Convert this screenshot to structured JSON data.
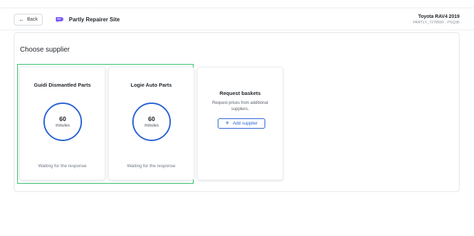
{
  "header": {
    "back_label": "Back",
    "brand_name": "Partly Repairer Site",
    "brand_color": "#7a5af5",
    "vehicle_name": "Toyota RAV4 2019",
    "vehicle_code": "PARTLY_7278590 - PSQ36"
  },
  "main": {
    "section_title": "Choose supplier",
    "selection_color": "#2fbf6a",
    "suppliers": [
      {
        "name": "Guidi Dismantled Parts",
        "timer_value": "60",
        "timer_unit": "minutes",
        "status": "Waiting for the response"
      },
      {
        "name": "Logie Auto Parts",
        "timer_value": "60",
        "timer_unit": "minutes",
        "status": "Waiting for the response"
      }
    ],
    "request_card": {
      "title": "Request baskets",
      "description": "Request prices from additional suppliers.",
      "button_label": "Add supplier",
      "button_icon": "plus-icon",
      "accent_color": "#2962d4"
    }
  }
}
